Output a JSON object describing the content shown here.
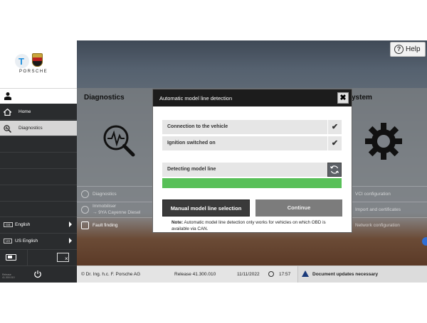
{
  "app": {
    "brand_mark": "T",
    "brand_name": "PORSCHE",
    "help_label": "Help"
  },
  "sidebar": {
    "items": [
      {
        "label": "Home",
        "icon": "home-icon"
      },
      {
        "label": "Diagnostics",
        "icon": "diagnostics-search-icon",
        "active": true
      }
    ],
    "languages": [
      {
        "badge": "GB",
        "label": "English"
      },
      {
        "badge": "US",
        "label": "US English"
      }
    ],
    "version_text": "Release 41.300.010"
  },
  "tiles": {
    "diagnostics": {
      "title": "Diagnostics",
      "items": [
        "Diagnostics",
        "Immobiliser\n→ 9YA Cayenne Diesel",
        "Fault finding"
      ]
    },
    "system": {
      "title": "ystem",
      "items": [
        "VCI configuration",
        "Import and certificates",
        "Network configuration"
      ]
    }
  },
  "statusbar": {
    "copyright": "© Dr. Ing. h.c. F. Porsche AG",
    "release": "Release 41.300.010",
    "date": "11/11/2022",
    "time": "17:57",
    "doc_update": "Document updates necessary"
  },
  "modal": {
    "title": "Automatic model line detection",
    "close_symbol": "✖",
    "rows": [
      {
        "label": "Connection to the vehicle",
        "status": "✔"
      },
      {
        "label": "Ignition switched on",
        "status": "✔"
      }
    ],
    "detecting_label": "Detecting model line",
    "progress": 1.0,
    "progress_color": "#58c058",
    "manual_button": "Manual model line selection",
    "continue_button": "Continue",
    "note_label": "Note:",
    "note_text": "Automatic model line detection only works for vehicles on which OBD is available via CAN."
  },
  "colors": {
    "accent_green": "#58c058",
    "sidebar_bg": "#2a2c2e",
    "status_blue": "#1a3a7a"
  }
}
